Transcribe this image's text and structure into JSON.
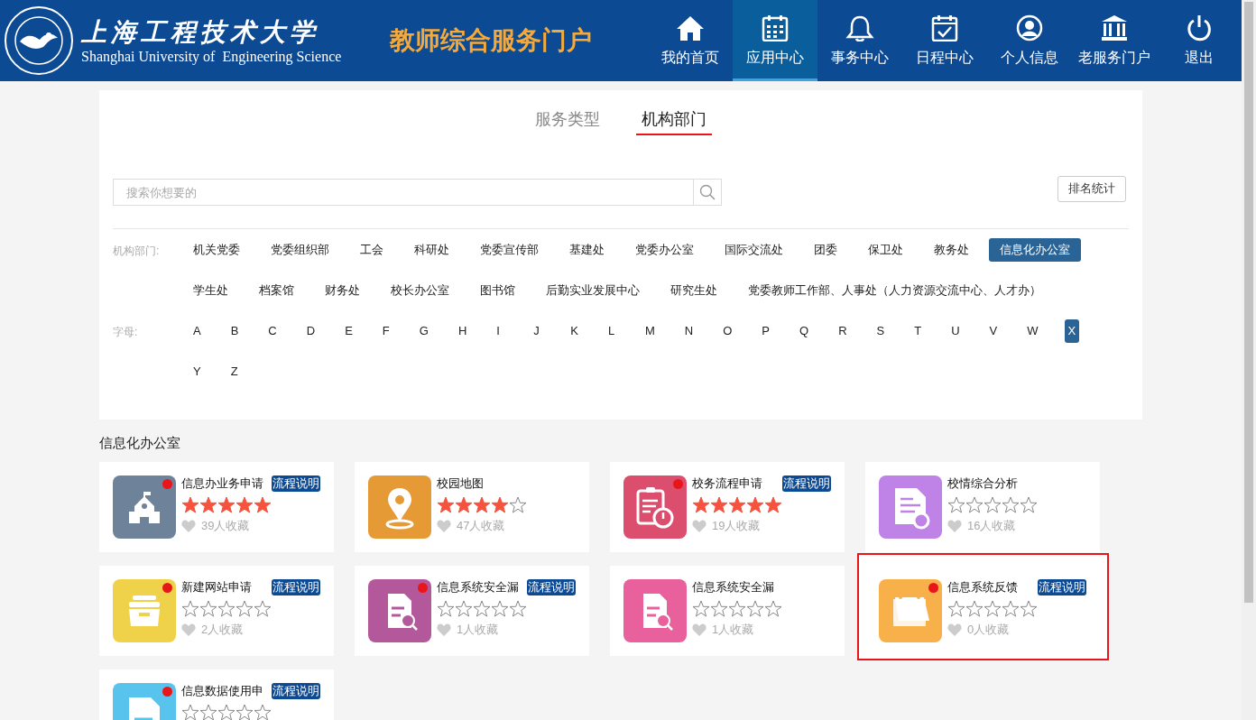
{
  "header": {
    "school_name": "上海工程技术大学",
    "school_name_en": "Shanghai University of  Engineering Science",
    "portal_title": "教师综合服务门户",
    "nav": [
      {
        "label": "我的首页",
        "kind": "home",
        "selected": false
      },
      {
        "label": "应用中心",
        "kind": "calendar",
        "selected": true
      },
      {
        "label": "事务中心",
        "kind": "bell",
        "selected": false
      },
      {
        "label": "日程中心",
        "kind": "check",
        "selected": false
      },
      {
        "label": "个人信息",
        "kind": "user",
        "selected": false
      },
      {
        "label": "老服务门户",
        "kind": "building",
        "selected": false
      },
      {
        "label": "退出",
        "kind": "power",
        "selected": false
      }
    ]
  },
  "tabs": [
    {
      "label": "服务类型",
      "selected": false
    },
    {
      "label": "机构部门",
      "selected": true
    }
  ],
  "search": {
    "placeholder": "搜索你想要的"
  },
  "ranking_button": "排名统计",
  "filters": [
    {
      "label": "机构部门:",
      "items": [
        {
          "label": "机关党委",
          "selected": false
        },
        {
          "label": "党委组织部",
          "selected": false
        },
        {
          "label": "工会",
          "selected": false
        },
        {
          "label": "科研处",
          "selected": false
        },
        {
          "label": "党委宣传部",
          "selected": false
        },
        {
          "label": "基建处",
          "selected": false
        },
        {
          "label": "党委办公室",
          "selected": false
        },
        {
          "label": "国际交流处",
          "selected": false
        },
        {
          "label": "团委",
          "selected": false
        },
        {
          "label": "保卫处",
          "selected": false
        },
        {
          "label": "教务处",
          "selected": false
        },
        {
          "label": "信息化办公室",
          "selected": true
        },
        {
          "label": "学生处",
          "selected": false
        },
        {
          "label": "档案馆",
          "selected": false
        },
        {
          "label": "财务处",
          "selected": false
        },
        {
          "label": "校长办公室",
          "selected": false
        },
        {
          "label": "图书馆",
          "selected": false
        },
        {
          "label": "后勤实业发展中心",
          "selected": false
        },
        {
          "label": "研究生处",
          "selected": false
        },
        {
          "label": "党委教师工作部、人事处（人力资源交流中心、人才办）",
          "selected": false
        }
      ]
    },
    {
      "label": "字母:",
      "items": [
        {
          "label": "A",
          "selected": false
        },
        {
          "label": "B",
          "selected": false
        },
        {
          "label": "C",
          "selected": false
        },
        {
          "label": "D",
          "selected": false
        },
        {
          "label": "E",
          "selected": false
        },
        {
          "label": "F",
          "selected": false
        },
        {
          "label": "G",
          "selected": false
        },
        {
          "label": "H",
          "selected": false
        },
        {
          "label": "I",
          "selected": false
        },
        {
          "label": "J",
          "selected": false
        },
        {
          "label": "K",
          "selected": false
        },
        {
          "label": "L",
          "selected": false
        },
        {
          "label": "M",
          "selected": false
        },
        {
          "label": "N",
          "selected": false
        },
        {
          "label": "O",
          "selected": false
        },
        {
          "label": "P",
          "selected": false
        },
        {
          "label": "Q",
          "selected": false
        },
        {
          "label": "R",
          "selected": false
        },
        {
          "label": "S",
          "selected": false
        },
        {
          "label": "T",
          "selected": false
        },
        {
          "label": "U",
          "selected": false
        },
        {
          "label": "V",
          "selected": false
        },
        {
          "label": "W",
          "selected": false
        },
        {
          "label": "X",
          "selected": true
        },
        {
          "label": "Y",
          "selected": false
        },
        {
          "label": "Z",
          "selected": false
        }
      ]
    }
  ],
  "section_title": "信息化办公室",
  "apps": [
    {
      "name": "信息办业务申请",
      "tag": "流程说明",
      "stars": 5,
      "favorites": "39人收藏",
      "kind": "school",
      "color": "#6e8299",
      "dot": true,
      "highlighted": false
    },
    {
      "name": "校园地图",
      "stars": 4,
      "favorites": "47人收藏",
      "kind": "pin",
      "color": "#e59a35",
      "dot": false,
      "highlighted": false
    },
    {
      "name": "校务流程申请",
      "tag": "流程说明",
      "stars": 5,
      "favorites": "19人收藏",
      "kind": "clipboard",
      "color": "#dc4e6e",
      "dot": true,
      "highlighted": false
    },
    {
      "name": "校情综合分析",
      "stars": 0,
      "favorites": "16人收藏",
      "kind": "report",
      "color": "#bf82e6",
      "dot": false,
      "highlighted": false
    },
    {
      "name": "新建网站申请",
      "tag": "流程说明",
      "stars": 0,
      "favorites": "2人收藏",
      "kind": "cabinet",
      "color": "#f0d24a",
      "dot": true,
      "highlighted": false
    },
    {
      "name": "信息系统安全漏",
      "tag": "流程说明",
      "stars": 0,
      "favorites": "1人收藏",
      "kind": "search",
      "color": "#b4589c",
      "dot": true,
      "highlighted": false
    },
    {
      "name": "信息系统安全漏",
      "stars": 0,
      "favorites": "1人收藏",
      "kind": "search",
      "color": "#e8609c",
      "dot": false,
      "highlighted": false
    },
    {
      "name": "信息系统反馈",
      "tag": "流程说明",
      "stars": 0,
      "favorites": "0人收藏",
      "kind": "calendar",
      "color": "#f8b04a",
      "dot": true,
      "highlighted": true
    },
    {
      "name": "信息数据使用申",
      "tag": "流程说明",
      "stars": 0,
      "kind": "document",
      "color": "#58c4ee",
      "dot": true,
      "highlighted": false
    }
  ]
}
